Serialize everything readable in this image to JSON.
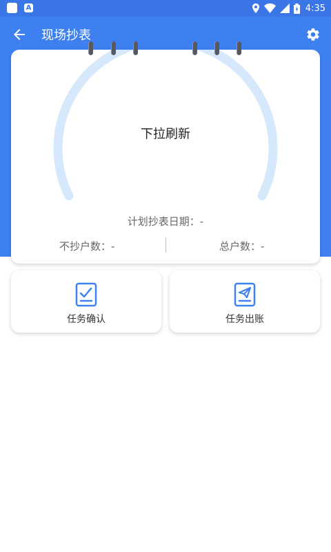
{
  "status_bar": {
    "time": "4:35",
    "icons": [
      "square-icon",
      "a-icon",
      "location-icon",
      "wifi-icon",
      "signal-icon",
      "battery-icon"
    ],
    "badge_letter": "A"
  },
  "app_bar": {
    "title": "现场抄表",
    "back_icon": "arrow-back-icon",
    "settings_icon": "gear-icon"
  },
  "meter_card": {
    "center_text": "下拉刷新",
    "plan_date_label": "计划抄表日期：-",
    "unread_label": "不抄户数：-",
    "total_label": "总户数：-"
  },
  "actions": [
    {
      "label": "任务确认",
      "icon": "task-confirm-icon"
    },
    {
      "label": "任务出账",
      "icon": "task-send-icon"
    }
  ],
  "colors": {
    "primary": "#3f80f1",
    "status_bar": "#3a76e6",
    "gauge_track": "#d6e8fb",
    "icon_blue": "#3f80f1"
  }
}
